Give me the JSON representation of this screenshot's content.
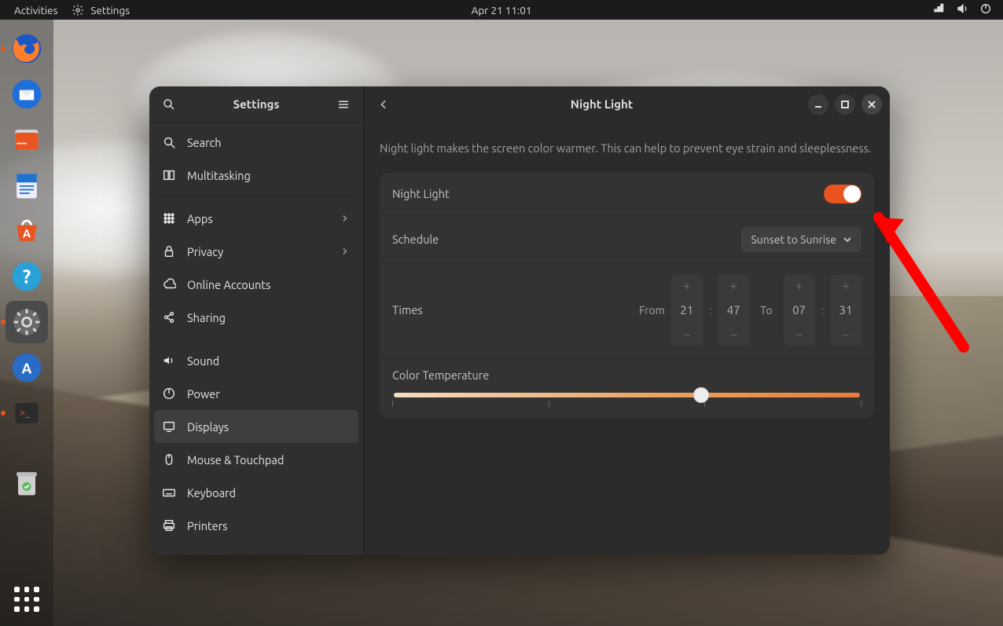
{
  "topbar": {
    "activities": "Activities",
    "app_indicator": "Settings",
    "datetime": "Apr 21  11:01"
  },
  "dock": {
    "apps": [
      {
        "name": "firefox"
      },
      {
        "name": "thunderbird"
      },
      {
        "name": "files"
      },
      {
        "name": "libreoffice-writer"
      },
      {
        "name": "ubuntu-software"
      },
      {
        "name": "help"
      },
      {
        "name": "settings",
        "running": true
      },
      {
        "name": "software-updater"
      },
      {
        "name": "terminal"
      },
      {
        "name": "trash"
      }
    ]
  },
  "window": {
    "sidebar_title": "Settings",
    "content_title": "Night Light",
    "sidebar_items": [
      {
        "label": "Search",
        "icon": "search"
      },
      {
        "label": "Multitasking",
        "icon": "multitask"
      },
      {
        "sep": true
      },
      {
        "label": "Apps",
        "icon": "apps",
        "more": true
      },
      {
        "label": "Privacy",
        "icon": "privacy",
        "more": true
      },
      {
        "label": "Online Accounts",
        "icon": "cloud"
      },
      {
        "label": "Sharing",
        "icon": "share"
      },
      {
        "sep": true
      },
      {
        "label": "Sound",
        "icon": "sound"
      },
      {
        "label": "Power",
        "icon": "power"
      },
      {
        "label": "Displays",
        "icon": "display",
        "selected": true
      },
      {
        "label": "Mouse & Touchpad",
        "icon": "mouse"
      },
      {
        "label": "Keyboard",
        "icon": "keyboard"
      },
      {
        "label": "Printers",
        "icon": "printer"
      }
    ]
  },
  "night_light": {
    "description": "Night light makes the screen color warmer. This can help to prevent eye strain and sleeplessness.",
    "toggle_label": "Night Light",
    "toggle_on": true,
    "schedule_label": "Schedule",
    "schedule_value": "Sunset to Sunrise",
    "times_label": "Times",
    "times_from_label": "From",
    "times_to_label": "To",
    "from_hour": "21",
    "from_min": "47",
    "to_hour": "07",
    "to_min": "31",
    "color_temp_label": "Color Temperature",
    "color_temp_value_pct": 66
  },
  "annotation": {
    "arrow_points_to": "night-light-toggle"
  }
}
